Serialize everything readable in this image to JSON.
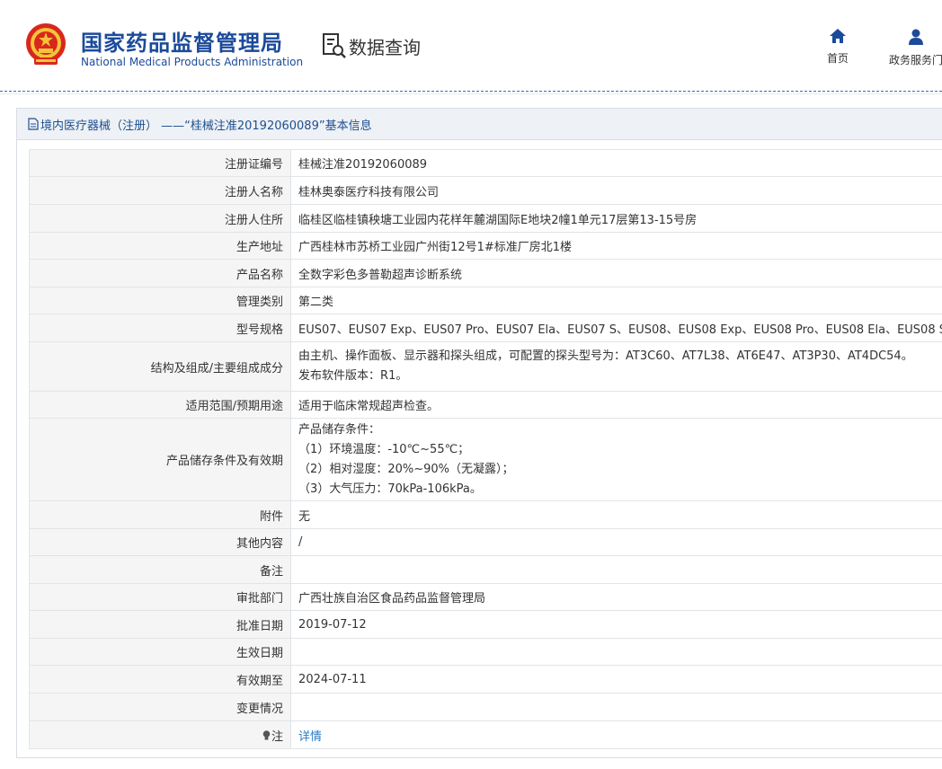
{
  "header": {
    "brand_cn": "国家药品监督管理局",
    "brand_en": "National Medical Products Administration",
    "query_title": "数据查询",
    "nav": [
      {
        "label": "首页",
        "icon": "home-icon"
      },
      {
        "label": "政务服务门",
        "icon": "user-icon"
      }
    ]
  },
  "colors": {
    "brand_blue": "#1b4a9b",
    "link": "#2a7bc7",
    "label_bg": "#f5f5f5"
  },
  "panel": {
    "title": "境内医疗器械（注册） ——“桂械注准20192060089”基本信息"
  },
  "rows": [
    {
      "label": "注册证编号",
      "value": "桂械注准20192060089"
    },
    {
      "label": "注册人名称",
      "value": "桂林奥泰医疗科技有限公司"
    },
    {
      "label": "注册人住所",
      "value": "临桂区临桂镇秧塘工业园内花样年麓湖国际E地块2幢1单元17层第13-15号房"
    },
    {
      "label": "生产地址",
      "value": "广西桂林市苏桥工业园广州街12号1#标准厂房北1楼"
    },
    {
      "label": "产品名称",
      "value": "全数字彩色多普勒超声诊断系统"
    },
    {
      "label": "管理类别",
      "value": "第二类"
    },
    {
      "label": "型号规格",
      "value": "EUS07、EUS07 Exp、EUS07 Pro、EUS07 Ela、EUS07 S、EUS08、EUS08 Exp、EUS08 Pro、EUS08 Ela、EUS08 S"
    },
    {
      "label": "结构及组成/主要组成成分",
      "lines": [
        "由主机、操作面板、显示器和探头组成，可配置的探头型号为：AT3C60、AT7L38、AT6E47、AT3P30、AT4DC54。",
        "发布软件版本：R1。"
      ]
    },
    {
      "label": "适用范围/预期用途",
      "value": "适用于临床常规超声检查。"
    },
    {
      "label": "产品储存条件及有效期",
      "lines": [
        "产品储存条件：",
        "（1）环境温度：-10℃~55℃；",
        "（2）相对湿度：20%~90%（无凝露）；",
        "（3）大气压力：70kPa-106kPa。"
      ]
    },
    {
      "label": "附件",
      "value": "无"
    },
    {
      "label": "其他内容",
      "value": "/"
    },
    {
      "label": "备注",
      "value": ""
    },
    {
      "label": "审批部门",
      "value": "广西壮族自治区食品药品监督管理局"
    },
    {
      "label": "批准日期",
      "value": "2019-07-12"
    },
    {
      "label": "生效日期",
      "value": ""
    },
    {
      "label": "有效期至",
      "value": "2024-07-11"
    },
    {
      "label": "变更情况",
      "value": ""
    },
    {
      "label": "注",
      "value": "详情"
    }
  ]
}
